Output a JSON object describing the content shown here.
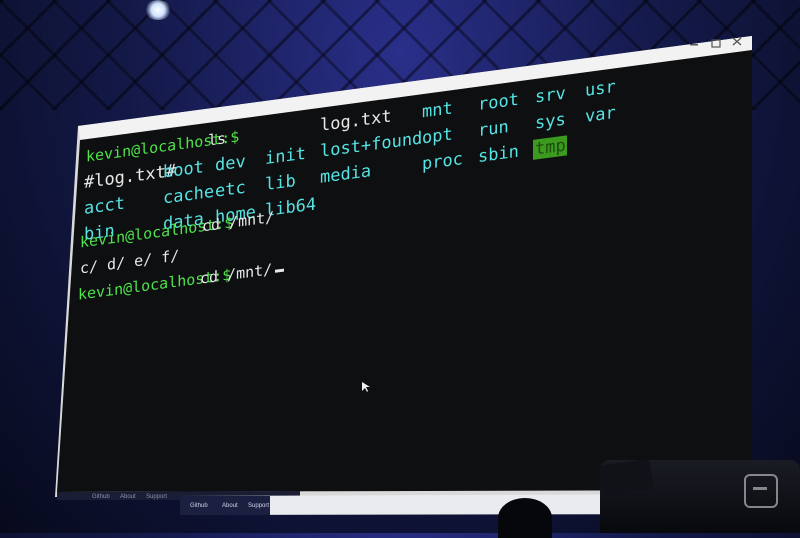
{
  "terminal": {
    "lines": [
      {
        "prompt": "kevin@localhost:$",
        "command": " ls"
      },
      {
        "prompt": "kevin@localhost:$",
        "command": " cd /mnt/"
      },
      {
        "prompt": "kevin@localhost:$",
        "command": " cd /mnt/"
      }
    ],
    "ls_output": [
      "#log.txt#",
      "acct",
      "bin",
      "boot",
      "cache",
      "data",
      "dev",
      "etc",
      "home",
      "init",
      "lib",
      "lib64",
      "log.txt",
      "lost+found",
      "media",
      "mnt",
      "opt",
      "proc",
      "root",
      "run",
      "sbin",
      "srv",
      "sys",
      "tmp",
      "usr",
      "var"
    ],
    "completion_output": "c/ d/ e/ f/",
    "highlighted_entry": "tmp"
  },
  "taskbar": {
    "items_back": [
      "Github",
      "About",
      "Support"
    ],
    "items_front": [
      "Github",
      "About",
      "Support"
    ]
  },
  "colors": {
    "prompt": "#4ee44a",
    "directory": "#56e3e3",
    "file": "#e8e8e8",
    "highlight_bg": "#3c9a1e",
    "terminal_bg": "#0e0f11"
  }
}
